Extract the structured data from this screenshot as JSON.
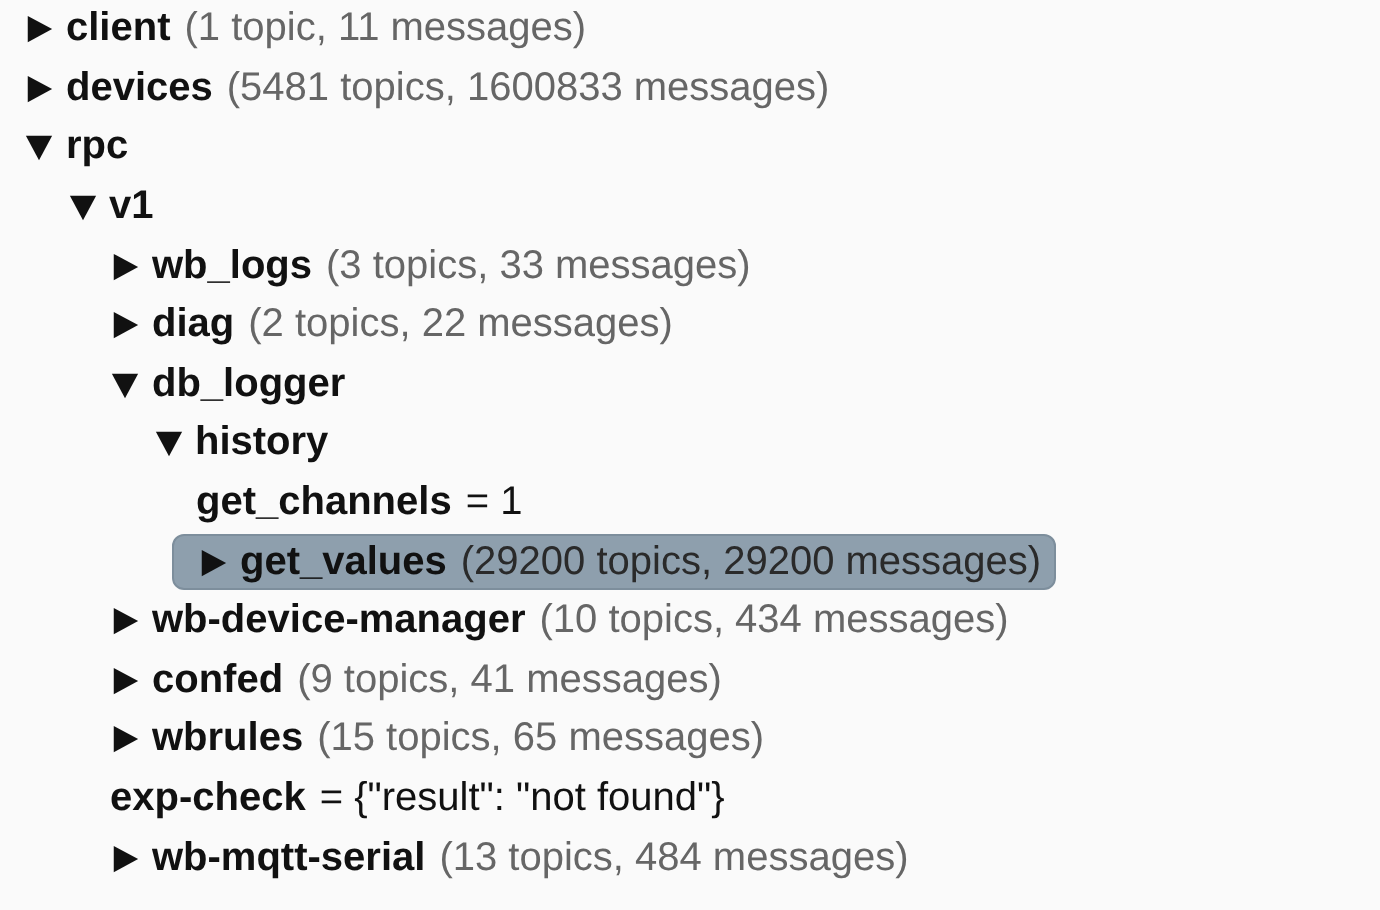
{
  "tree": [
    {
      "kind": "topic",
      "name": "client",
      "summary": "(1 topic, 11 messages)",
      "expanded": false,
      "selected": false
    },
    {
      "kind": "topic",
      "name": "devices",
      "summary": "(5481 topics, 1600833 messages)",
      "expanded": false,
      "selected": false
    },
    {
      "kind": "topic",
      "name": "rpc",
      "expanded": true,
      "selected": false,
      "children": [
        {
          "kind": "topic",
          "name": "v1",
          "expanded": true,
          "selected": false,
          "children": [
            {
              "kind": "topic",
              "name": "wb_logs",
              "summary": "(3 topics, 33 messages)",
              "expanded": false,
              "selected": false
            },
            {
              "kind": "topic",
              "name": "diag",
              "summary": "(2 topics, 22 messages)",
              "expanded": false,
              "selected": false
            },
            {
              "kind": "topic",
              "name": "db_logger",
              "expanded": true,
              "selected": false,
              "children": [
                {
                  "kind": "topic",
                  "name": "history",
                  "expanded": true,
                  "selected": false,
                  "children": [
                    {
                      "kind": "value",
                      "name": "get_channels",
                      "value": "= 1",
                      "selected": false
                    },
                    {
                      "kind": "topic",
                      "name": "get_values",
                      "summary": "(29200 topics, 29200 messages)",
                      "expanded": false,
                      "selected": true
                    }
                  ]
                }
              ]
            },
            {
              "kind": "topic",
              "name": "wb-device-manager",
              "summary": "(10 topics, 434 messages)",
              "expanded": false,
              "selected": false
            },
            {
              "kind": "topic",
              "name": "confed",
              "summary": "(9 topics, 41 messages)",
              "expanded": false,
              "selected": false
            },
            {
              "kind": "topic",
              "name": "wbrules",
              "summary": "(15 topics, 65 messages)",
              "expanded": false,
              "selected": false
            },
            {
              "kind": "value",
              "name": "exp-check",
              "value": "= {\"result\": \"not found\"}",
              "selected": false
            },
            {
              "kind": "topic",
              "name": "wb-mqtt-serial",
              "summary": "(13 topics, 484 messages)",
              "expanded": false,
              "selected": false
            }
          ]
        }
      ]
    }
  ]
}
